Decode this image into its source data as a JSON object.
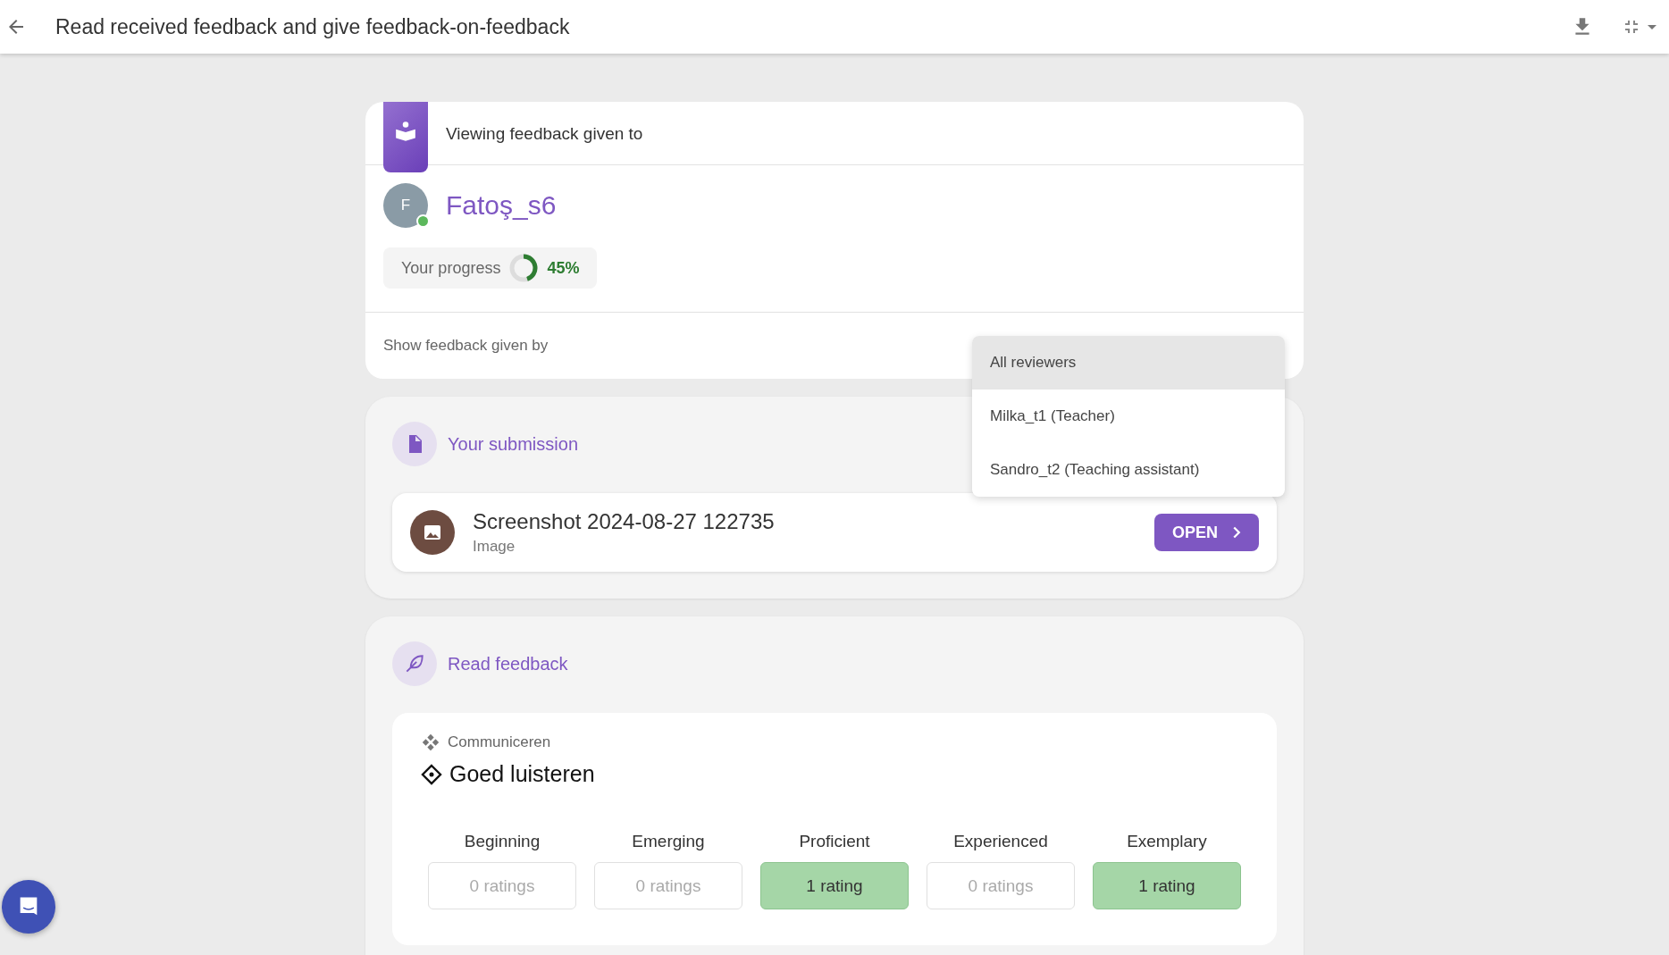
{
  "top_bar": {
    "title": "Read received feedback and give feedback-on-feedback"
  },
  "header_card": {
    "heading": "Viewing feedback given to",
    "student": {
      "initial": "F",
      "name": "Fatoş_s6",
      "online": true
    },
    "progress": {
      "label": "Your progress",
      "level": 0.45,
      "reading": "45%"
    },
    "filter_label": "Show feedback given by"
  },
  "reviewer_menu": [
    {
      "label": "All reviewers",
      "selected": true
    },
    {
      "label": "Milka_t1 (Teacher)",
      "selected": false
    },
    {
      "label": "Sandro_t2 (Teaching assistant)",
      "selected": false
    }
  ],
  "submission": {
    "heading": "Your submission",
    "file": {
      "name": "Screenshot 2024-08-27 122735",
      "type": "Image"
    },
    "button": "OPEN"
  },
  "feedback": {
    "heading": "Read feedback",
    "criterion": {
      "group": "Communiceren",
      "name": "Goed luisteren",
      "levels": [
        {
          "label": "Beginning",
          "count": "0 ratings",
          "rated": false
        },
        {
          "label": "Emerging",
          "count": "0 ratings",
          "rated": false
        },
        {
          "label": "Proficient",
          "count": "1 rating",
          "rated": true
        },
        {
          "label": "Experienced",
          "count": "0 ratings",
          "rated": false
        },
        {
          "label": "Exemplary",
          "count": "1 rating",
          "rated": true
        }
      ]
    }
  }
}
